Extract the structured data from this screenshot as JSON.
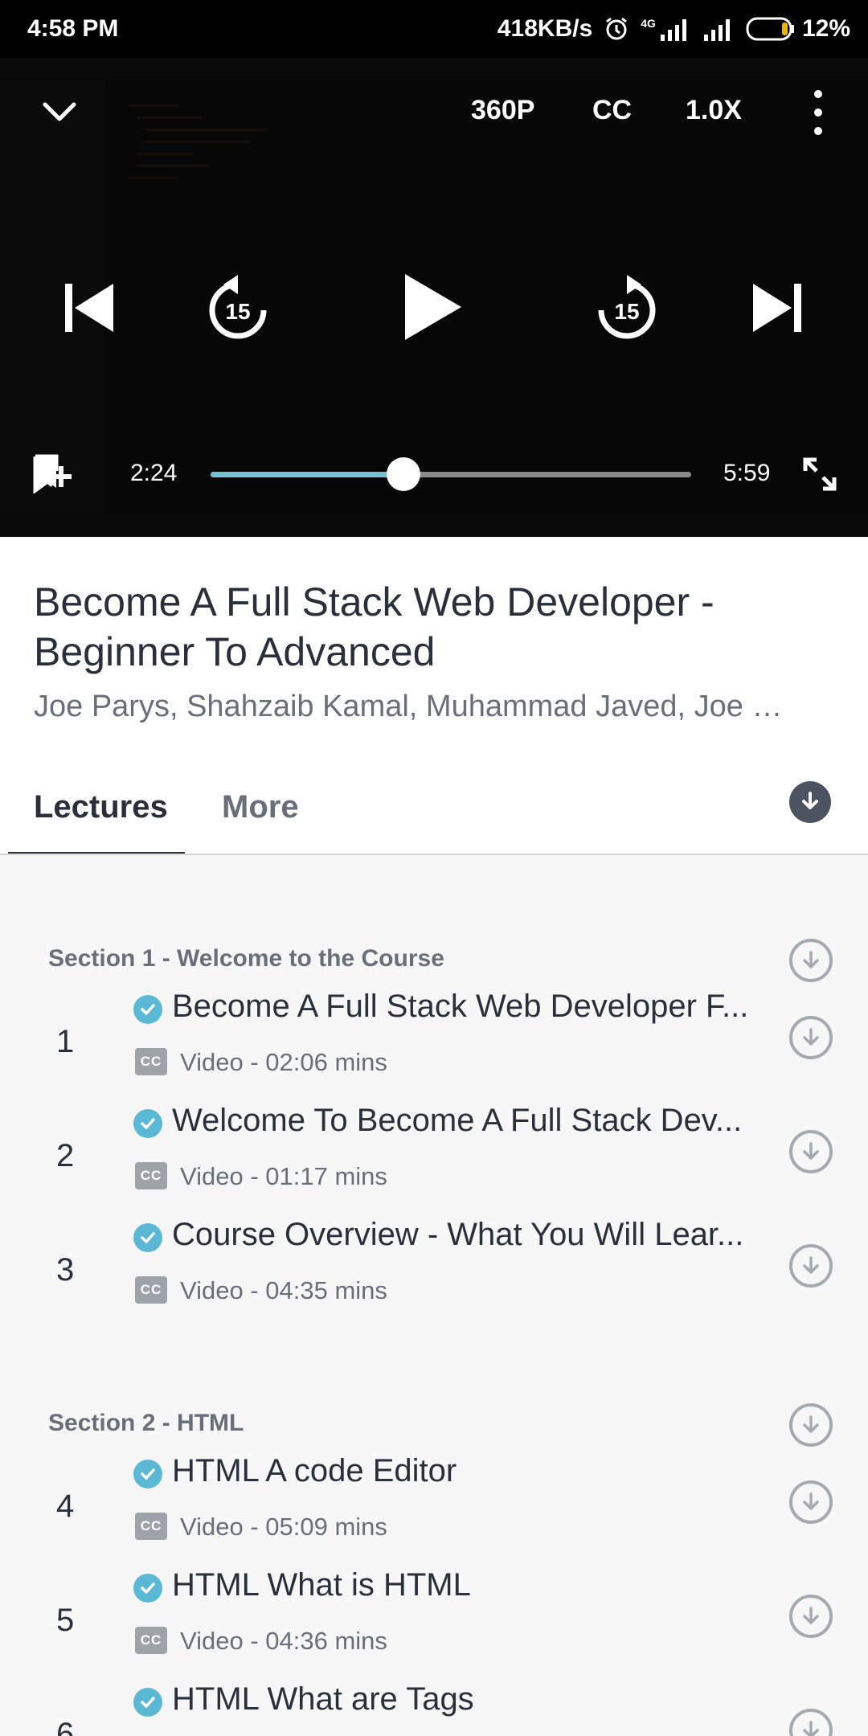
{
  "status_bar": {
    "time": "4:58 PM",
    "network_speed": "418KB/s",
    "network_type": "4G",
    "battery": "12%"
  },
  "player": {
    "quality": "360P",
    "captions": "CC",
    "speed": "1.0X",
    "skip_seconds": "15",
    "current_time": "2:24",
    "duration": "5:59",
    "progress_fraction": 0.401,
    "accent_color": "#76c2d4"
  },
  "course": {
    "title": "Become A Full Stack Web Developer - Beginner To Advanced",
    "instructors": "Joe Parys, Shahzaib Kamal, Muhammad Javed, Joe …"
  },
  "tabs": {
    "lectures": "Lectures",
    "more": "More"
  },
  "sections": [
    {
      "title": "Section 1 - Welcome to the Course",
      "lectures": [
        {
          "number": "1",
          "title": "Become A Full Stack Web Developer F...",
          "meta": "Video - 02:06 mins"
        },
        {
          "number": "2",
          "title": "Welcome To Become A Full Stack Dev...",
          "meta": "Video - 01:17 mins"
        },
        {
          "number": "3",
          "title": "Course Overview - What You Will Lear...",
          "meta": "Video - 04:35 mins"
        }
      ]
    },
    {
      "title": "Section 2 - HTML",
      "lectures": [
        {
          "number": "4",
          "title": "HTML A code Editor",
          "meta": "Video - 05:09 mins"
        },
        {
          "number": "5",
          "title": "HTML What is HTML",
          "meta": "Video - 04:36 mins"
        },
        {
          "number": "6",
          "title": "HTML What are Tags",
          "meta": ""
        }
      ]
    }
  ],
  "icons": {
    "collapse": "chevron-down-icon",
    "more": "kebab-menu-icon",
    "previous": "skip-previous-icon",
    "rewind": "rewind-15-icon",
    "play": "play-icon",
    "forward": "forward-15-icon",
    "next": "skip-next-icon",
    "bookmark": "bookmark-add-icon",
    "fullscreen": "fullscreen-icon",
    "download": "download-icon",
    "completed": "check-circle-icon",
    "captions": "closed-captions-icon"
  }
}
